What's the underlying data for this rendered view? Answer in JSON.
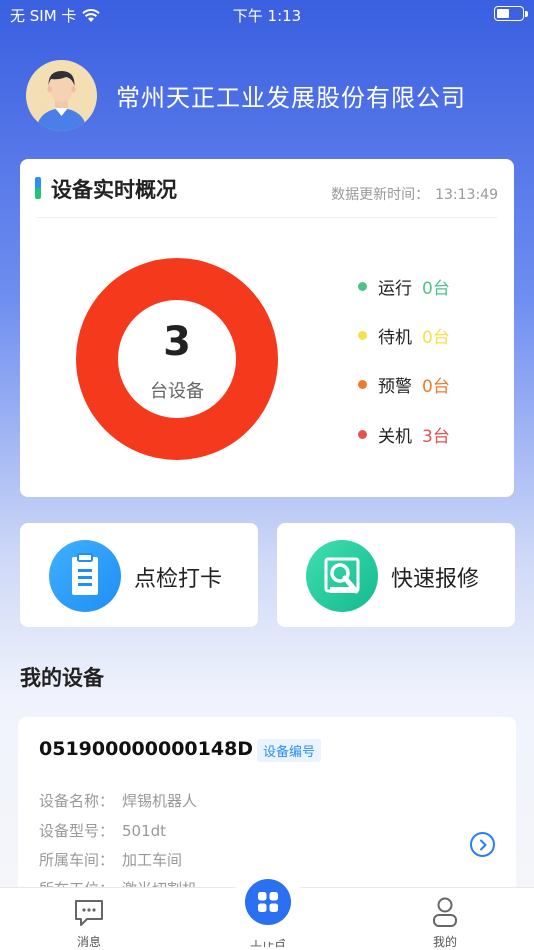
{
  "status_bar": {
    "carrier": "无 SIM 卡",
    "time": "下午 1:13",
    "battery_level": 0.5
  },
  "header": {
    "company": "常州天正工业发展股份有限公司",
    "avatar_icon": "user-avatar-icon"
  },
  "overview": {
    "title": "设备实时概况",
    "update_label": "数据更新时间：",
    "update_time": "13:13:49",
    "total": "3",
    "total_label": "台设备",
    "legend": [
      {
        "name": "运行",
        "value": "0台",
        "color": "#4cc38a"
      },
      {
        "name": "待机",
        "value": "0台",
        "color": "#f6e04b"
      },
      {
        "name": "预警",
        "value": "0台",
        "color": "#f07a2c"
      },
      {
        "name": "关机",
        "value": "3台",
        "color": "#e5514e"
      }
    ],
    "chart_data": {
      "type": "pie",
      "categories": [
        "运行",
        "待机",
        "预警",
        "关机"
      ],
      "values": [
        0,
        0,
        0,
        3
      ],
      "colors": [
        "#4cc38a",
        "#f6e04b",
        "#f07a2c",
        "#f5391c"
      ]
    }
  },
  "actions": [
    {
      "label": "点检打卡",
      "icon": "clipboard-icon"
    },
    {
      "label": "快速报修",
      "icon": "repair-wrench-icon"
    }
  ],
  "my_devices": {
    "title": "我的设备",
    "device": {
      "id": "051900000000148D",
      "tag": "设备编号",
      "rows": [
        {
          "label": "设备名称：",
          "value": "焊锡机器人"
        },
        {
          "label": "设备型号：",
          "value": "501dt"
        },
        {
          "label": "所属车间：",
          "value": "加工车间"
        },
        {
          "label": "所在工位：",
          "value": "激光切割机"
        }
      ]
    }
  },
  "tabs": [
    {
      "label": "消息",
      "icon": "message-icon"
    },
    {
      "label": "工作台",
      "icon": "grid-icon"
    },
    {
      "label": "我的",
      "icon": "person-icon"
    }
  ]
}
